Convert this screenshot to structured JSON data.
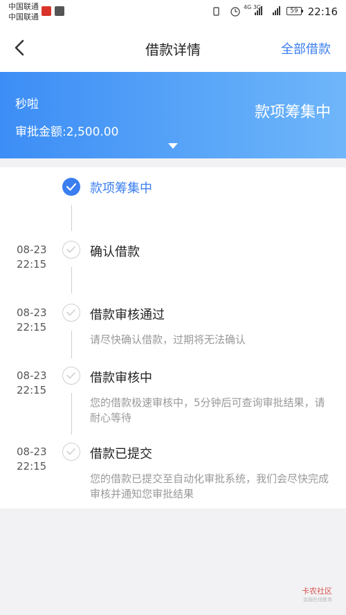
{
  "status_bar": {
    "carrier1": "中国联通",
    "carrier2": "中国联通",
    "network": "4G 3G",
    "battery": "59",
    "time": "22:16"
  },
  "nav": {
    "title": "借款详情",
    "right_action": "全部借款",
    "back_icon": "chevron-left-icon"
  },
  "banner": {
    "name": "秒啦",
    "amount": "审批金额:2,500.00",
    "status": "款项筹集中",
    "gradient_start": "#3c8df6",
    "gradient_end": "#6fb6fa"
  },
  "timeline": {
    "accent": "#3a7ef0",
    "items": [
      {
        "date": "",
        "time": "",
        "title": "款项筹集中",
        "desc": "",
        "state": "active"
      },
      {
        "date": "08-23",
        "time": "22:15",
        "title": "确认借款",
        "desc": "",
        "state": "done"
      },
      {
        "date": "08-23",
        "time": "22:15",
        "title": "借款审核通过",
        "desc": "请尽快确认借款，过期将无法确认",
        "state": "done"
      },
      {
        "date": "08-23",
        "time": "22:15",
        "title": "借款审核中",
        "desc": "您的借款极速审核中，5分钟后可查询审批结果，请耐心等待",
        "state": "done"
      },
      {
        "date": "08-23",
        "time": "22:15",
        "title": "借款已提交",
        "desc": "您的借款已提交至自动化审批系统，我们会尽快完成审核并通知您审批结果",
        "state": "done"
      }
    ]
  },
  "watermark": {
    "text": "卡农社区",
    "sub": "金融在线教育"
  }
}
